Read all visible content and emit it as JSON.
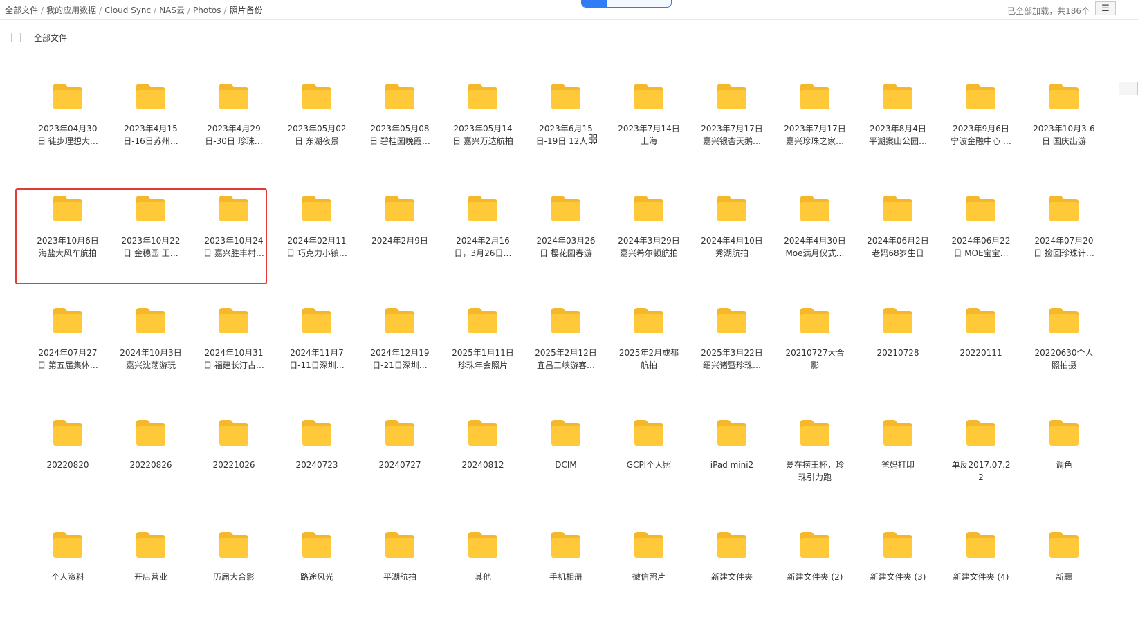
{
  "breadcrumb": [
    {
      "label": "全部文件"
    },
    {
      "label": "我的应用数据"
    },
    {
      "label": "Cloud Sync"
    },
    {
      "label": "NAS云"
    },
    {
      "label": "Photos"
    },
    {
      "label": "照片备份"
    }
  ],
  "header": {
    "status": "已全部加载，共186个",
    "list_view_icon": "list-view-icon",
    "grid_view_icon": "grid-view-icon"
  },
  "subheader": {
    "select_all_label": "全部文件"
  },
  "colors": {
    "accent": "#2f7cf6",
    "folder_body": "#ffc93a",
    "folder_tab": "#f5b82a",
    "highlight": "#e53935"
  },
  "folders": [
    {
      "name": "2023年04月30日 徒步理想大…"
    },
    {
      "name": "2023年4月15日-16日苏州…"
    },
    {
      "name": "2023年4月29日-30日 珍珠…"
    },
    {
      "name": "2023年05月02日 东湖夜景"
    },
    {
      "name": "2023年05月08日 碧桂园晚霞…"
    },
    {
      "name": "2023年05月14日 嘉兴万达航拍"
    },
    {
      "name": "2023年6月15日-19日 12人…"
    },
    {
      "name": "2023年7月14日上海"
    },
    {
      "name": "2023年7月17日嘉兴银杏天鹅…"
    },
    {
      "name": "2023年7月17日嘉兴珍珠之家…"
    },
    {
      "name": "2023年8月4日平湖案山公园…"
    },
    {
      "name": "2023年9月6日宁波金融中心 …"
    },
    {
      "name": "2023年10月3-6日 国庆出游"
    },
    {
      "name": "2023年10月6日海盐大风车航拍"
    },
    {
      "name": "2023年10月22日 金穗园 王…"
    },
    {
      "name": "2023年10月24日 嘉兴胜丰村…"
    },
    {
      "name": "2024年02月11日 巧克力小镇…"
    },
    {
      "name": "2024年2月9日"
    },
    {
      "name": "2024年2月16日，3月26日…"
    },
    {
      "name": "2024年03月26日 樱花园春游"
    },
    {
      "name": "2024年3月29日嘉兴希尔顿航拍"
    },
    {
      "name": "2024年4月10日秀湖航拍"
    },
    {
      "name": "2024年4月30日Moe满月仪式…"
    },
    {
      "name": "2024年06月2日老妈68岁生日"
    },
    {
      "name": "2024年06月22日 MOE宝宝…"
    },
    {
      "name": "2024年07月20日 捡回珍珠计…"
    },
    {
      "name": "2024年07月27日 第五届集体…"
    },
    {
      "name": "2024年10月3日嘉兴沈荡游玩"
    },
    {
      "name": "2024年10月31日 福建长汀古…"
    },
    {
      "name": "2024年11月7日-11日深圳…"
    },
    {
      "name": "2024年12月19日-21日深圳…"
    },
    {
      "name": "2025年1月11日珍珠年会照片"
    },
    {
      "name": "2025年2月12日宜昌三峡游客…"
    },
    {
      "name": "2025年2月成都航拍"
    },
    {
      "name": "2025年3月22日绍兴诸暨珍珠…"
    },
    {
      "name": "20210727大合影"
    },
    {
      "name": "20210728"
    },
    {
      "name": "20220111"
    },
    {
      "name": "20220630个人照拍摄"
    },
    {
      "name": "20220820"
    },
    {
      "name": "20220826"
    },
    {
      "name": "20221026"
    },
    {
      "name": "20240723"
    },
    {
      "name": "20240727"
    },
    {
      "name": "20240812"
    },
    {
      "name": "DCIM"
    },
    {
      "name": "GCPI个人照"
    },
    {
      "name": "iPad mini2"
    },
    {
      "name": "爱在捞王杯，珍珠引力跑"
    },
    {
      "name": "爸妈打印"
    },
    {
      "name": "单反2017.07.22"
    },
    {
      "name": "调色"
    },
    {
      "name": "个人资料"
    },
    {
      "name": "开店营业"
    },
    {
      "name": "历届大合影"
    },
    {
      "name": "路途风光"
    },
    {
      "name": "平湖航拍"
    },
    {
      "name": "其他"
    },
    {
      "name": "手机相册"
    },
    {
      "name": "微信照片"
    },
    {
      "name": "新建文件夹"
    },
    {
      "name": "新建文件夹 (2)"
    },
    {
      "name": "新建文件夹 (3)"
    },
    {
      "name": "新建文件夹 (4)"
    },
    {
      "name": "新疆"
    }
  ]
}
